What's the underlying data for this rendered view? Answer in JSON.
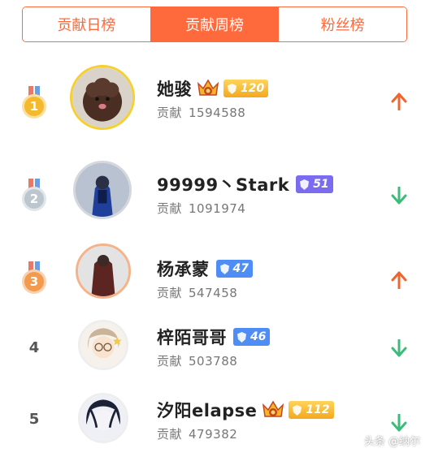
{
  "tabs": [
    {
      "label": "贡献日榜",
      "active": false
    },
    {
      "label": "贡献周榜",
      "active": true
    },
    {
      "label": "粉丝榜",
      "active": false
    }
  ],
  "contrib_label": "贡献",
  "entries": [
    {
      "rank": "1",
      "name": "她骏",
      "crown": true,
      "level": "120",
      "level_color": "gold",
      "contribution": "1594588",
      "trend": "up"
    },
    {
      "rank": "2",
      "name": "99999丶Stark",
      "crown": false,
      "level": "51",
      "level_color": "purple",
      "contribution": "1091974",
      "trend": "down"
    },
    {
      "rank": "3",
      "name": "杨承蒙",
      "crown": false,
      "level": "47",
      "level_color": "blue",
      "contribution": "547458",
      "trend": "up"
    },
    {
      "rank": "4",
      "name": "梓陌哥哥",
      "crown": false,
      "level": "46",
      "level_color": "blue",
      "contribution": "503788",
      "trend": "down"
    },
    {
      "rank": "5",
      "name": "汐阳elapse",
      "crown": true,
      "level": "112",
      "level_color": "gold",
      "contribution": "479382",
      "trend": "down"
    }
  ],
  "colors": {
    "accent": "#ff6a3d",
    "up": "#f0642d",
    "down": "#3dbb7a"
  },
  "watermark": "头条 @纳尔"
}
